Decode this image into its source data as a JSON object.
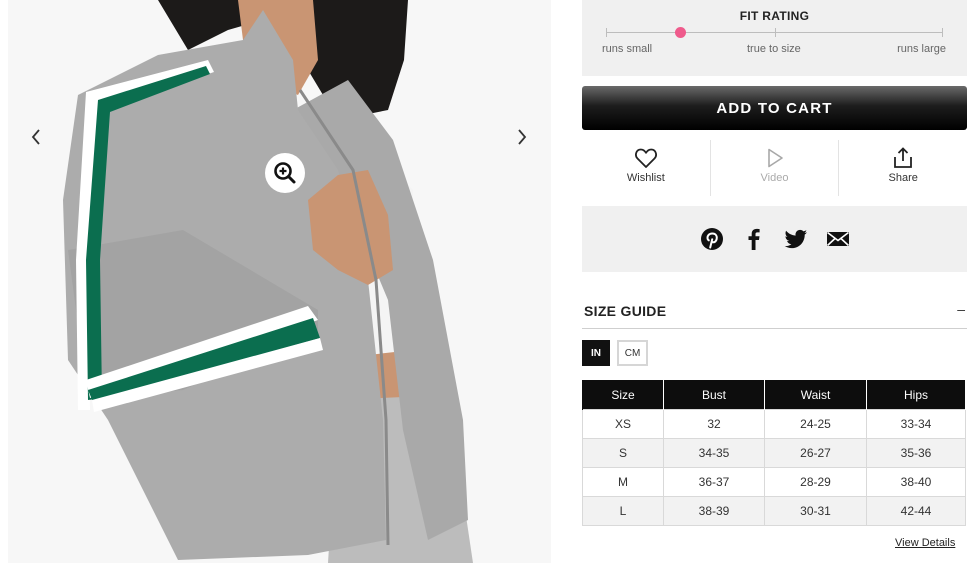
{
  "gallery": {
    "prev_icon": "chevron-left-icon",
    "next_icon": "chevron-right-icon",
    "zoom_icon": "zoom-in-icon",
    "colors": {
      "jacket": "#a9a9a9",
      "stripe_green": "#0b6e4f",
      "stripe_white": "#ffffff",
      "background": "#f7f7f7"
    }
  },
  "fit_rating": {
    "title": "FIT RATING",
    "labels": [
      "runs small",
      "true to size",
      "runs large"
    ],
    "value": 0.22,
    "dot_color": "#ef5b8c"
  },
  "cart": {
    "label": "ADD TO CART"
  },
  "actions": [
    {
      "label": "Wishlist",
      "icon": "heart-icon",
      "enabled": true
    },
    {
      "label": "Video",
      "icon": "play-icon",
      "enabled": false
    },
    {
      "label": "Share",
      "icon": "share-icon",
      "enabled": true
    }
  ],
  "social": [
    "pinterest-icon",
    "facebook-icon",
    "twitter-icon",
    "email-icon"
  ],
  "size_guide": {
    "title": "SIZE GUIDE",
    "toggle": "–",
    "units": [
      "IN",
      "CM"
    ],
    "selected_unit": "IN",
    "columns": [
      "Size",
      "Bust",
      "Waist",
      "Hips"
    ],
    "rows": [
      [
        "XS",
        "32",
        "24-25",
        "33-34"
      ],
      [
        "S",
        "34-35",
        "26-27",
        "35-36"
      ],
      [
        "M",
        "36-37",
        "28-29",
        "38-40"
      ],
      [
        "L",
        "38-39",
        "30-31",
        "42-44"
      ]
    ],
    "view_details": "View Details"
  }
}
